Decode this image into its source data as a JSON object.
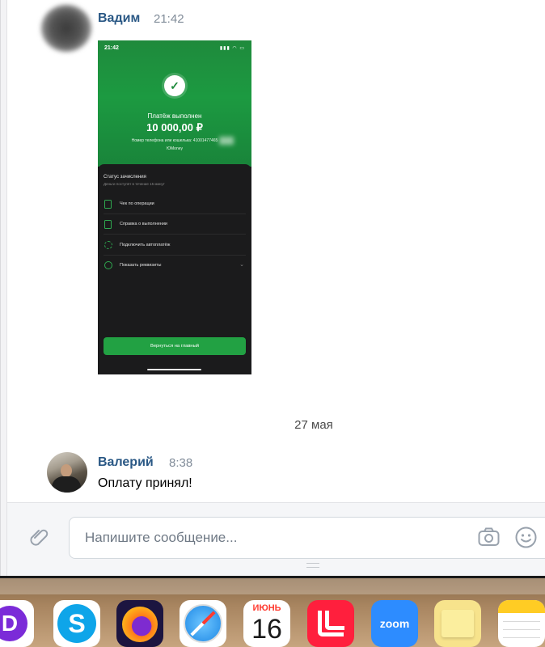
{
  "messages": [
    {
      "author": "Вадим",
      "time": "21:42",
      "attachment": {
        "status_time": "21:42",
        "status_icons": "▮▮▮ ◠ ▭",
        "title": "Платёж выполнен",
        "amount": "10 000,00 ₽",
        "phone_line": "Номер телефона или кошелька: 41001477465",
        "wallet": "ЮMoney",
        "status_title": "Статус зачисления",
        "status_sub": "Деньги поступят в течение 15 минут",
        "rows": [
          {
            "label": "Чек по операции",
            "icon": "document-icon"
          },
          {
            "label": "Справка о выполнении",
            "icon": "document-icon"
          },
          {
            "label": "Подключить автоплатёж",
            "icon": "sync-icon"
          },
          {
            "label": "Показать реквизиты",
            "icon": "info-icon"
          }
        ],
        "button": "Вернуться на главный"
      }
    },
    {
      "author": "Валерий",
      "time": "8:38",
      "text": "Оплату принял!"
    }
  ],
  "date_separator": "27 мая",
  "composer": {
    "placeholder": "Напишите сообщение..."
  },
  "dock": {
    "calendar_month": "ИЮНЬ",
    "calendar_day": "16",
    "zoom_label": "zoom",
    "d_letter": "D",
    "skype_letter": "S"
  },
  "colors": {
    "author": "#2a5885",
    "payment_green": "#1c9a41",
    "button_green": "#22a143"
  }
}
